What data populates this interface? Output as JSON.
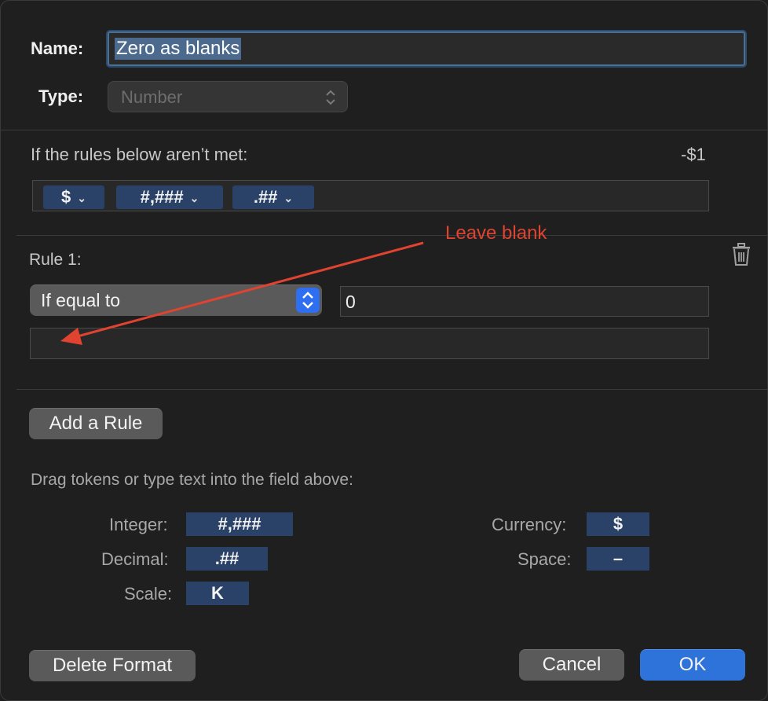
{
  "dialog": {
    "name_label": "Name:",
    "name_value": "Zero as blanks",
    "type_label": "Type:",
    "type_value": "Number",
    "rules_header": "If the rules below aren’t met:",
    "preview_value": "-$1",
    "format_tokens": [
      "$",
      "#,###",
      ".##"
    ],
    "rule": {
      "label": "Rule 1:",
      "condition": "If equal to",
      "value": "0",
      "format_field": ""
    },
    "annotation": "Leave blank",
    "add_rule": "Add a Rule",
    "drag_hint": "Drag tokens or type text into the field above:",
    "tokens_palette": {
      "integer_label": "Integer:",
      "integer_token": "#,###",
      "decimal_label": "Decimal:",
      "decimal_token": ".##",
      "scale_label": "Scale:",
      "scale_token": "K",
      "currency_label": "Currency:",
      "currency_token": "$",
      "space_label": "Space:",
      "space_token": "–"
    },
    "delete_format": "Delete Format",
    "cancel": "Cancel",
    "ok": "OK"
  },
  "colors": {
    "accent": "#2e73d9",
    "annotation": "#e0432f",
    "token_bg": "#2a4268"
  },
  "icons": [
    "chevron-updown-icon",
    "chevron-down-icon",
    "trash-icon",
    "arrow-annotation"
  ]
}
